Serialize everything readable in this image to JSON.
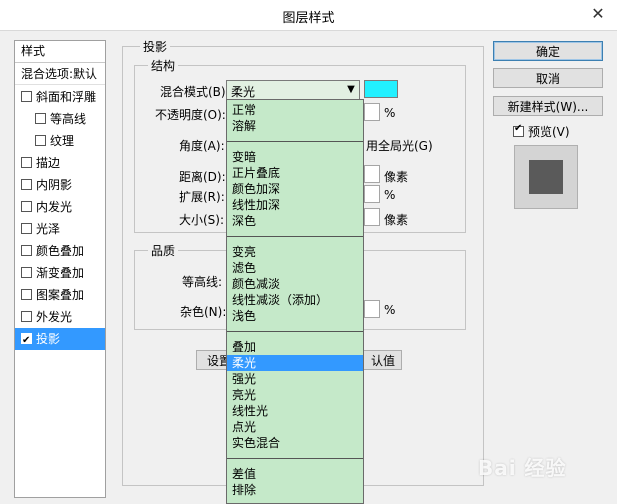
{
  "window": {
    "title": "图层样式",
    "close_glyph": "✕"
  },
  "buttons": {
    "ok": "确定",
    "cancel": "取消",
    "new_style": "新建样式(W)...",
    "preview": "预览(V)"
  },
  "sidebar": {
    "header": "样式",
    "blend_options": "混合选项:默认",
    "items": [
      {
        "label": "斜面和浮雕",
        "checked": false
      },
      {
        "label": "等高线",
        "checked": false
      },
      {
        "label": "纹理",
        "checked": false
      },
      {
        "label": "描边",
        "checked": false
      },
      {
        "label": "内阴影",
        "checked": false
      },
      {
        "label": "内发光",
        "checked": false
      },
      {
        "label": "光泽",
        "checked": false
      },
      {
        "label": "颜色叠加",
        "checked": false
      },
      {
        "label": "渐变叠加",
        "checked": false
      },
      {
        "label": "图案叠加",
        "checked": false
      },
      {
        "label": "外发光",
        "checked": false
      },
      {
        "label": "投影",
        "checked": true
      }
    ]
  },
  "panel": {
    "section": "投影",
    "structure": {
      "title": "结构",
      "blend_mode_label": "混合模式(B):",
      "blend_mode_value": "柔光",
      "shadow_color": "#22f0ff",
      "opacity_label": "不透明度(O):",
      "opacity_unit": "%",
      "angle_label": "角度(A):",
      "global_light_fragment": "用全局光(G)",
      "distance_label": "距离(D):",
      "distance_unit": "像素",
      "spread_label": "扩展(R):",
      "spread_unit": "%",
      "size_label": "大小(S):",
      "size_unit": "像素"
    },
    "quality": {
      "title": "品质",
      "contour_label": "等高线:",
      "noise_label": "杂色(N):",
      "noise_unit": "%"
    },
    "bottom": {
      "left_fragment": "设置",
      "right_fragment": "认值"
    }
  },
  "dropdown": {
    "groups": [
      [
        "正常",
        "溶解"
      ],
      [
        "变暗",
        "正片叠底",
        "颜色加深",
        "线性加深",
        "深色"
      ],
      [
        "变亮",
        "滤色",
        "颜色减淡",
        "线性减淡（添加）",
        "浅色"
      ],
      [
        "叠加",
        "柔光",
        "强光",
        "亮光",
        "线性光",
        "点光",
        "实色混合"
      ],
      [
        "差值",
        "排除"
      ]
    ],
    "selected": "柔光"
  },
  "watermark": "Bai 经验"
}
